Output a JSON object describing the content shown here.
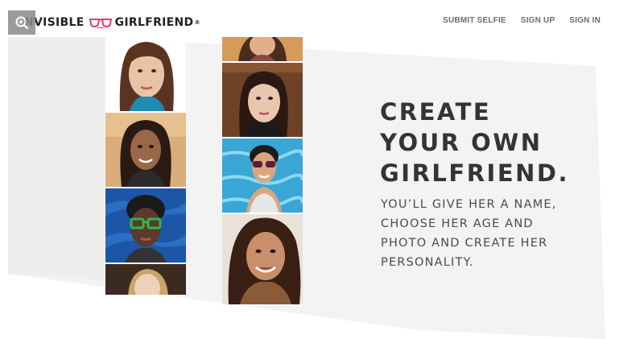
{
  "brand": {
    "prefix": "NVISIBLE",
    "suffix": "GIRLFRIEND",
    "trademark": "®",
    "glasses_color": "#e83b6f"
  },
  "nav": {
    "submit_selfie": "SUBMIT SELFIE",
    "sign_up": "SIGN UP",
    "sign_in": "SIGN IN"
  },
  "hero": {
    "headline": [
      "CREATE",
      "YOUR OWN",
      "GIRLFRIEND."
    ],
    "subtext": [
      "YOU’LL GIVE HER A NAME,",
      "CHOOSE HER AGE AND",
      "PHOTO AND CREATE HER",
      "PERSONALITY."
    ]
  },
  "colors": {
    "panel": "#f2f2f2",
    "headline": "#343434",
    "nav": "#6d6d6d"
  },
  "icons": {
    "zoom": "magnifier-icon",
    "glasses": "glasses-icon"
  }
}
